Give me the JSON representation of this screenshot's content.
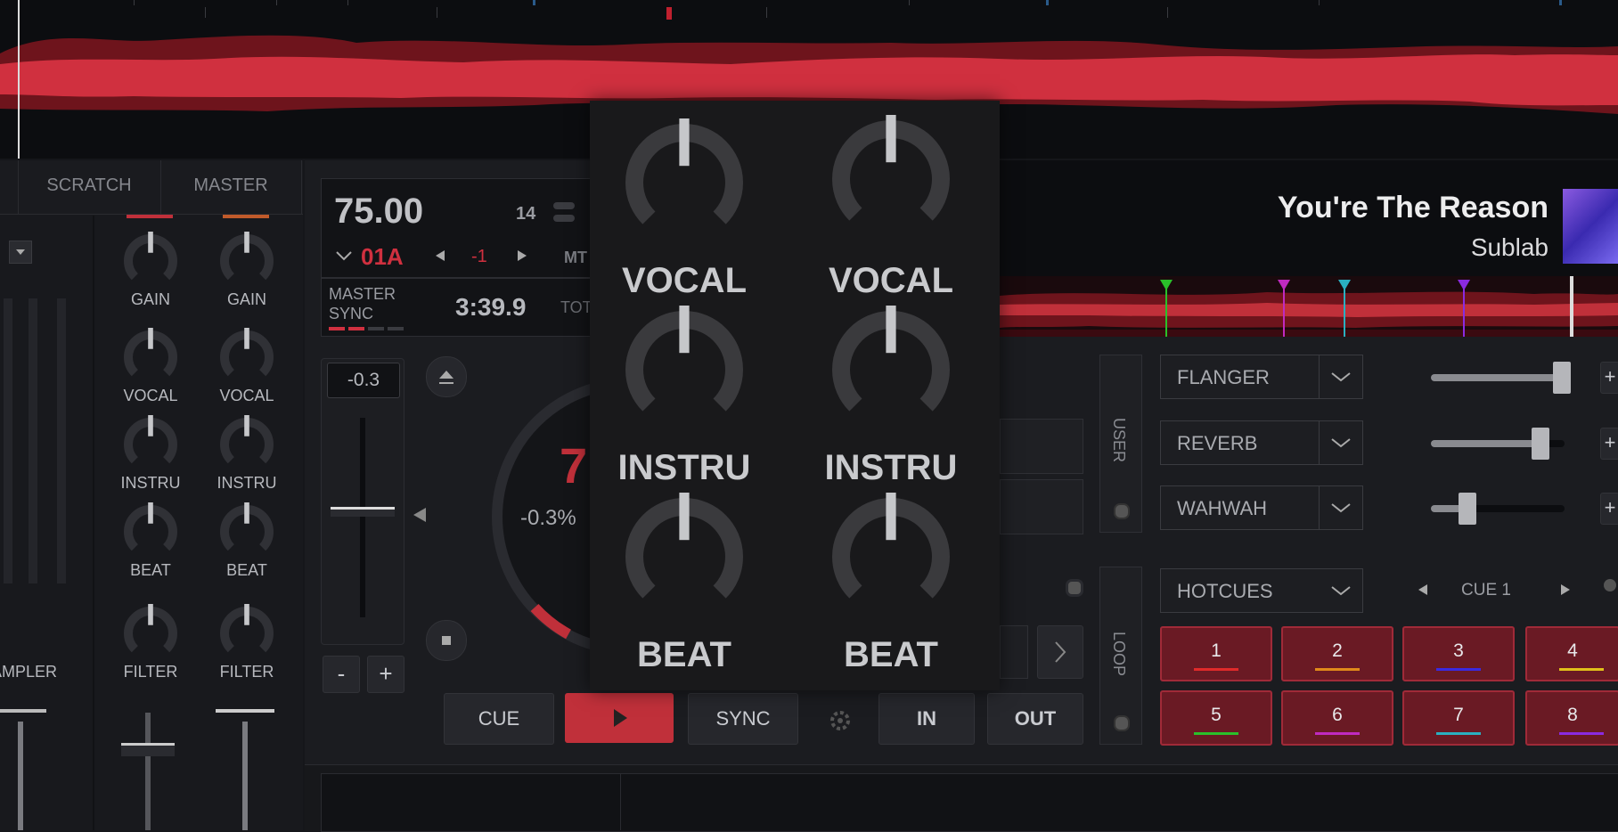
{
  "deck": {
    "bpm": "75.00",
    "key_label": "01A",
    "key_shift": "-1",
    "small_number": "14",
    "mt_label": "MT",
    "master_sync_label": "MASTER\nSYNC",
    "time": "3:39.9",
    "total_label": "TOT",
    "pitch_value": "-0.3",
    "pitch_percent": "-0.3%",
    "minus": "-",
    "plus": "+",
    "jog_bpm_partial": "7"
  },
  "track": {
    "title": "You're The Reason",
    "artist": "Sublab"
  },
  "mixer": {
    "tabs": [
      "SCRATCH",
      "MASTER"
    ],
    "knob_labels": [
      "GAIN",
      "VOCAL",
      "INSTRU",
      "BEAT",
      "FILTER"
    ],
    "sampler_label": "AMPLER"
  },
  "popup": {
    "labels": [
      "VOCAL",
      "INSTRU",
      "BEAT"
    ]
  },
  "effects": {
    "user_label": "USER",
    "loop_label": "LOOP",
    "items": [
      {
        "name": "FLANGER",
        "level": 0.98
      },
      {
        "name": "REVERB",
        "level": 0.82
      },
      {
        "name": "WAHWAH",
        "level": 0.27
      }
    ],
    "hotcues_label": "HOTCUES",
    "cue_label": "CUE 1"
  },
  "transport": {
    "cue": "CUE",
    "sync": "SYNC",
    "in": "IN",
    "out": "OUT"
  },
  "pads": [
    {
      "n": "1",
      "color": "#e02a2a"
    },
    {
      "n": "2",
      "color": "#e08a1a"
    },
    {
      "n": "3",
      "color": "#3a2ae0"
    },
    {
      "n": "4",
      "color": "#e0c01a"
    },
    {
      "n": "5",
      "color": "#2ac02a"
    },
    {
      "n": "6",
      "color": "#c02ac0"
    },
    {
      "n": "7",
      "color": "#2ab0c0"
    },
    {
      "n": "8",
      "color": "#8a2ae0"
    }
  ]
}
